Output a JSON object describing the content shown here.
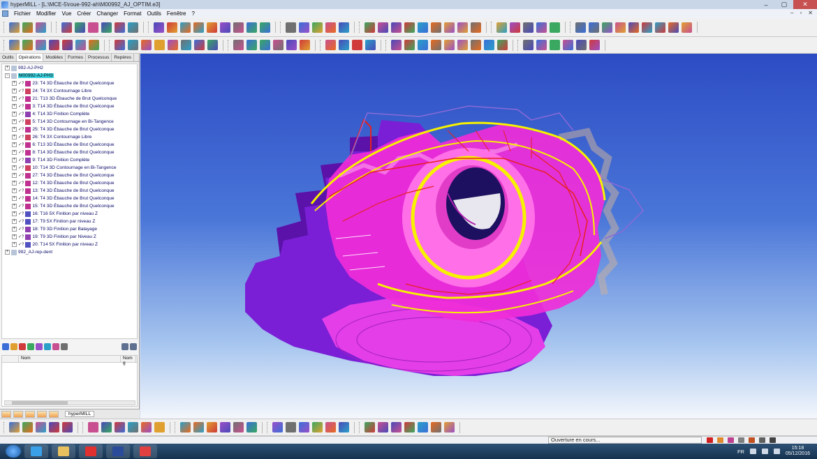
{
  "window": {
    "title": "hyperMILL - [L:\\MCE-5\\roue-992-ah\\M00992_AJ_OPTIM.e3]",
    "controls": [
      "–",
      "▢",
      "✕"
    ],
    "mdi_controls": [
      "–",
      "▫",
      "✕"
    ]
  },
  "menu": [
    "Fichier",
    "Modifier",
    "Vue",
    "Créer",
    "Changer",
    "Format",
    "Outils",
    "Fenêtre",
    "?"
  ],
  "left_panel": {
    "tabs": [
      "Outils",
      "Opérations",
      "Modèles",
      "Formes",
      "Processus",
      "Repères"
    ],
    "active_tab": "Opérations",
    "tree": [
      {
        "label": "992-AJ-PH2",
        "level": 0,
        "expander": "+",
        "type": "folder",
        "marks": ""
      },
      {
        "label": "M00992-AJ-PH3",
        "level": 0,
        "expander": "−",
        "type": "folder",
        "marks": "",
        "selected": true
      },
      {
        "label": "23: T4 3D Ébauche de Brut Quelconque",
        "level": 1,
        "expander": "+",
        "type": "rough",
        "marks": "✓?"
      },
      {
        "label": "24: T4 3X Contournage Libre",
        "level": 1,
        "expander": "+",
        "type": "contour",
        "marks": "✓?"
      },
      {
        "label": "21: T13 3D Ébauche de Brut Quelconque",
        "level": 1,
        "expander": "+",
        "type": "rough",
        "marks": "✓?"
      },
      {
        "label": "3: T14 3D Ébauche de Brut Quelconque",
        "level": 1,
        "expander": "+",
        "type": "rough",
        "marks": "✓?"
      },
      {
        "label": "4: T14 3D Finition Complète",
        "level": 1,
        "expander": "+",
        "type": "finish",
        "marks": "✓?"
      },
      {
        "label": "5: T14 3D Contournage en Bi-Tangence",
        "level": 1,
        "expander": "+",
        "type": "contour",
        "marks": "✓?"
      },
      {
        "label": "25: T4 3D Ébauche de Brut Quelconque",
        "level": 1,
        "expander": "+",
        "type": "rough",
        "marks": "✓?"
      },
      {
        "label": "26: T4 3X Contournage Libre",
        "level": 1,
        "expander": "+",
        "type": "contour",
        "marks": "✓?"
      },
      {
        "label": "6: T13 3D Ébauche de Brut Quelconque",
        "level": 1,
        "expander": "+",
        "type": "rough",
        "marks": "✓?"
      },
      {
        "label": "8: T14 3D Ébauche de Brut Quelconque",
        "level": 1,
        "expander": "+",
        "type": "rough",
        "marks": "✓?"
      },
      {
        "label": "9: T14 3D Finition Complète",
        "level": 1,
        "expander": "+",
        "type": "finish",
        "marks": "✓?"
      },
      {
        "label": "10: T14 3D Contournage en Bi-Tangence",
        "level": 1,
        "expander": "+",
        "type": "contour",
        "marks": "✓?"
      },
      {
        "label": "27: T4 3D Ébauche de Brut Quelconque",
        "level": 1,
        "expander": "+",
        "type": "rough",
        "marks": "✓?"
      },
      {
        "label": "12: T4 3D Ébauche de Brut Quelconque",
        "level": 1,
        "expander": "+",
        "type": "rough",
        "marks": "✓?"
      },
      {
        "label": "13: T4 3D Ébauche de Brut Quelconque",
        "level": 1,
        "expander": "+",
        "type": "rough",
        "marks": "✓?"
      },
      {
        "label": "14: T4 3D Ébauche de Brut Quelconque",
        "level": 1,
        "expander": "+",
        "type": "rough",
        "marks": "✓?"
      },
      {
        "label": "15: T4 3D Ébauche de Brut Quelconque",
        "level": 1,
        "expander": "+",
        "type": "rough",
        "marks": "✓?"
      },
      {
        "label": "16: T16 5X Finition par niveau Z",
        "level": 1,
        "expander": "+",
        "type": "5x",
        "marks": "✓?"
      },
      {
        "label": "17: T9 5X Finition par niveau Z",
        "level": 1,
        "expander": "+",
        "type": "5x",
        "marks": "✓?"
      },
      {
        "label": "18: T9 3D Finition par Balayage",
        "level": 1,
        "expander": "+",
        "type": "finish",
        "marks": "✓?"
      },
      {
        "label": "19: T9 3D Finition par Niveau Z",
        "level": 1,
        "expander": "+",
        "type": "finish",
        "marks": "✓?"
      },
      {
        "label": "20: T14 5X Finition par niveau Z",
        "level": 1,
        "expander": "+",
        "type": "5x",
        "marks": "✓?"
      },
      {
        "label": "992_AJ-rep-dent",
        "level": 0,
        "expander": "+",
        "type": "folder",
        "marks": ""
      }
    ],
    "list_columns": [
      "Nom",
      "Nom g"
    ],
    "bottom_tab_label": "hyperMILL"
  },
  "status": {
    "message": "Ouverture en cours..."
  },
  "taskbar": {
    "language": "FR",
    "time": "15:18",
    "date": "05/12/2016"
  },
  "colors": {
    "accent_selection": "#3fd3e0",
    "part_purple": "#7a1fd6",
    "part_magenta": "#ff3ee0",
    "toolpath_yellow": "#f6f200",
    "toolpath_red": "#e8201e",
    "viewport_top": "#2c4cc4",
    "viewport_bottom": "#f4f7fc"
  }
}
